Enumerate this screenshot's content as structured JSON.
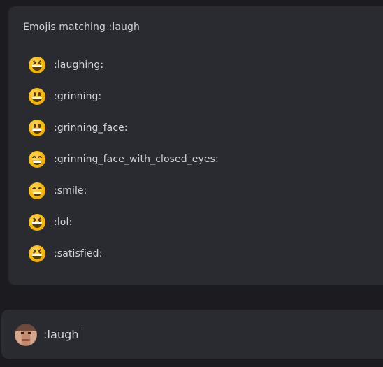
{
  "emoji_panel": {
    "title": "Emojis matching :laugh",
    "items": [
      {
        "label": ":laughing:",
        "icon": "laughing-face-icon",
        "style": "laughing"
      },
      {
        "label": ":grinning:",
        "icon": "grinning-face-icon",
        "style": "grin"
      },
      {
        "label": ":grinning_face:",
        "icon": "grinning-face-icon",
        "style": "grin"
      },
      {
        "label": ":grinning_face_with_closed_eyes:",
        "icon": "grinning-face-with-closed-eyes-icon",
        "style": "smile"
      },
      {
        "label": ":smile:",
        "icon": "smile-face-icon",
        "style": "smile"
      },
      {
        "label": ":lol:",
        "icon": "laughing-face-icon",
        "style": "laughing"
      },
      {
        "label": ":satisfied:",
        "icon": "laughing-face-icon",
        "style": "laughing"
      }
    ]
  },
  "composer": {
    "value": ":laugh",
    "avatar": "user-avatar"
  },
  "colors": {
    "background": "#1b1b20",
    "panel": "#2a2b31",
    "text": "#cfd2d8",
    "emoji_yellow": "#f6b700"
  }
}
